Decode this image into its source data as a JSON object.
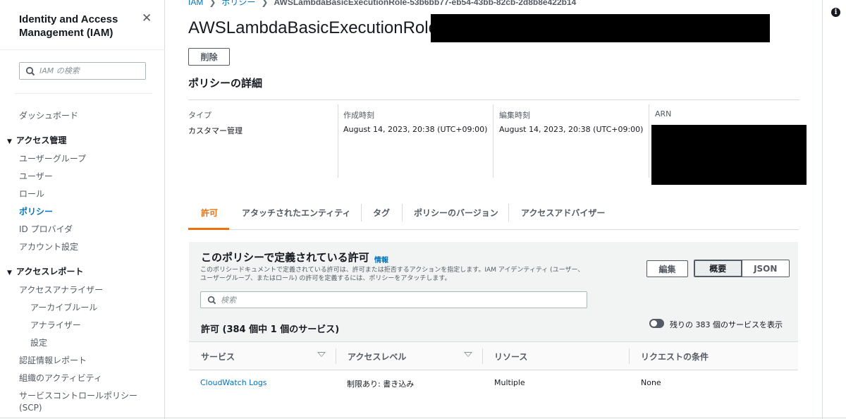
{
  "sidebar": {
    "title": "Identity and Access Management (IAM)",
    "search_placeholder": "IAM の検索",
    "dashboard": "ダッシュボード",
    "access_management": {
      "label": "アクセス管理",
      "items": [
        "ユーザーグループ",
        "ユーザー",
        "ロール",
        "ポリシー",
        "ID プロバイダ",
        "アカウント設定"
      ],
      "active": "ポリシー"
    },
    "access_reports": {
      "label": "アクセスレポート",
      "items": [
        "アクセスアナライザー",
        "アーカイブルール",
        "アナライザー",
        "設定",
        "認証情報レポート",
        "組織のアクティビティ",
        "サービスコントロールポリシー",
        "(SCP)"
      ]
    }
  },
  "breadcrumb": {
    "items": [
      "IAM",
      "ポリシー"
    ],
    "current": "AWSLambdaBasicExecutionRole-53b6bb77-eb54-43bb-82cb-2d8b8e422b14"
  },
  "page": {
    "title": "AWSLambdaBasicExecutionRole",
    "delete_button": "削除",
    "details_heading": "ポリシーの詳細",
    "details": {
      "type_label": "タイプ",
      "type_value": "カスタマー管理",
      "created_label": "作成時刻",
      "created_value": "August 14, 2023, 20:38 (UTC+09:00)",
      "edited_label": "編集時刻",
      "edited_value": "August 14, 2023, 20:38 (UTC+09:00)",
      "arn_label": "ARN"
    }
  },
  "tabs": [
    "許可",
    "アタッチされたエンティティ",
    "タグ",
    "ポリシーのバージョン",
    "アクセスアドバイザー"
  ],
  "permissions": {
    "title": "このポリシーで定義されている許可",
    "info_link": "情報",
    "description": "このポリシードキュメントで定義されている許可は、許可または拒否するアクションを指定します。IAM アイデンティティ (ユーザー、ユーザーグループ、またはロール) の許可を定義するには、ポリシーをアタッチします。",
    "edit_button": "編集",
    "summary_button": "概要",
    "json_button": "JSON",
    "search_placeholder": "検索",
    "count_text": "許可 (384 個中 1 個のサービス)",
    "toggle_label": "残りの 383 個のサービスを表示",
    "columns": [
      "サービス",
      "アクセスレベル",
      "リソース",
      "リクエストの条件"
    ],
    "rows": [
      {
        "service": "CloudWatch Logs",
        "access_level": "制限あり: 書き込み",
        "resource": "Multiple",
        "condition": "None"
      }
    ]
  },
  "colors": {
    "accent": "#ec7211",
    "link": "#0073bb",
    "text": "#16191f"
  }
}
